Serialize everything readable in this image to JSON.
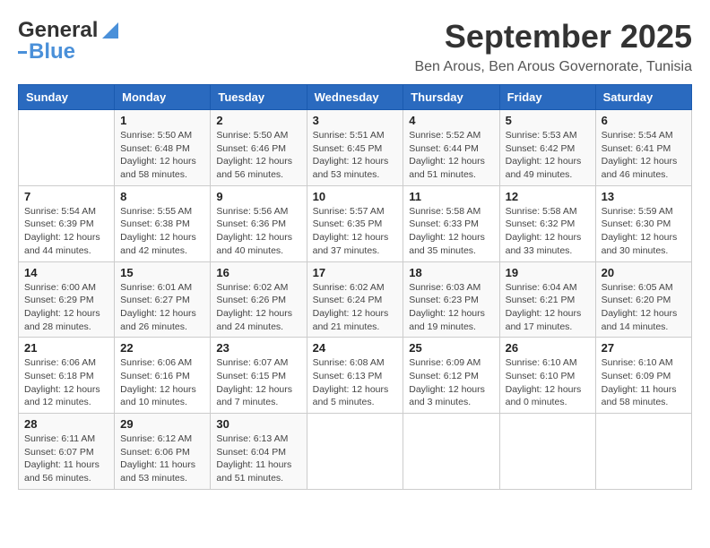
{
  "header": {
    "logo": {
      "text1": "General",
      "text2": "Blue"
    },
    "title": "September 2025",
    "location": "Ben Arous, Ben Arous Governorate, Tunisia"
  },
  "weekdays": [
    "Sunday",
    "Monday",
    "Tuesday",
    "Wednesday",
    "Thursday",
    "Friday",
    "Saturday"
  ],
  "weeks": [
    [
      {
        "day": "",
        "info": ""
      },
      {
        "day": "1",
        "info": "Sunrise: 5:50 AM\nSunset: 6:48 PM\nDaylight: 12 hours\nand 58 minutes."
      },
      {
        "day": "2",
        "info": "Sunrise: 5:50 AM\nSunset: 6:46 PM\nDaylight: 12 hours\nand 56 minutes."
      },
      {
        "day": "3",
        "info": "Sunrise: 5:51 AM\nSunset: 6:45 PM\nDaylight: 12 hours\nand 53 minutes."
      },
      {
        "day": "4",
        "info": "Sunrise: 5:52 AM\nSunset: 6:44 PM\nDaylight: 12 hours\nand 51 minutes."
      },
      {
        "day": "5",
        "info": "Sunrise: 5:53 AM\nSunset: 6:42 PM\nDaylight: 12 hours\nand 49 minutes."
      },
      {
        "day": "6",
        "info": "Sunrise: 5:54 AM\nSunset: 6:41 PM\nDaylight: 12 hours\nand 46 minutes."
      }
    ],
    [
      {
        "day": "7",
        "info": "Sunrise: 5:54 AM\nSunset: 6:39 PM\nDaylight: 12 hours\nand 44 minutes."
      },
      {
        "day": "8",
        "info": "Sunrise: 5:55 AM\nSunset: 6:38 PM\nDaylight: 12 hours\nand 42 minutes."
      },
      {
        "day": "9",
        "info": "Sunrise: 5:56 AM\nSunset: 6:36 PM\nDaylight: 12 hours\nand 40 minutes."
      },
      {
        "day": "10",
        "info": "Sunrise: 5:57 AM\nSunset: 6:35 PM\nDaylight: 12 hours\nand 37 minutes."
      },
      {
        "day": "11",
        "info": "Sunrise: 5:58 AM\nSunset: 6:33 PM\nDaylight: 12 hours\nand 35 minutes."
      },
      {
        "day": "12",
        "info": "Sunrise: 5:58 AM\nSunset: 6:32 PM\nDaylight: 12 hours\nand 33 minutes."
      },
      {
        "day": "13",
        "info": "Sunrise: 5:59 AM\nSunset: 6:30 PM\nDaylight: 12 hours\nand 30 minutes."
      }
    ],
    [
      {
        "day": "14",
        "info": "Sunrise: 6:00 AM\nSunset: 6:29 PM\nDaylight: 12 hours\nand 28 minutes."
      },
      {
        "day": "15",
        "info": "Sunrise: 6:01 AM\nSunset: 6:27 PM\nDaylight: 12 hours\nand 26 minutes."
      },
      {
        "day": "16",
        "info": "Sunrise: 6:02 AM\nSunset: 6:26 PM\nDaylight: 12 hours\nand 24 minutes."
      },
      {
        "day": "17",
        "info": "Sunrise: 6:02 AM\nSunset: 6:24 PM\nDaylight: 12 hours\nand 21 minutes."
      },
      {
        "day": "18",
        "info": "Sunrise: 6:03 AM\nSunset: 6:23 PM\nDaylight: 12 hours\nand 19 minutes."
      },
      {
        "day": "19",
        "info": "Sunrise: 6:04 AM\nSunset: 6:21 PM\nDaylight: 12 hours\nand 17 minutes."
      },
      {
        "day": "20",
        "info": "Sunrise: 6:05 AM\nSunset: 6:20 PM\nDaylight: 12 hours\nand 14 minutes."
      }
    ],
    [
      {
        "day": "21",
        "info": "Sunrise: 6:06 AM\nSunset: 6:18 PM\nDaylight: 12 hours\nand 12 minutes."
      },
      {
        "day": "22",
        "info": "Sunrise: 6:06 AM\nSunset: 6:16 PM\nDaylight: 12 hours\nand 10 minutes."
      },
      {
        "day": "23",
        "info": "Sunrise: 6:07 AM\nSunset: 6:15 PM\nDaylight: 12 hours\nand 7 minutes."
      },
      {
        "day": "24",
        "info": "Sunrise: 6:08 AM\nSunset: 6:13 PM\nDaylight: 12 hours\nand 5 minutes."
      },
      {
        "day": "25",
        "info": "Sunrise: 6:09 AM\nSunset: 6:12 PM\nDaylight: 12 hours\nand 3 minutes."
      },
      {
        "day": "26",
        "info": "Sunrise: 6:10 AM\nSunset: 6:10 PM\nDaylight: 12 hours\nand 0 minutes."
      },
      {
        "day": "27",
        "info": "Sunrise: 6:10 AM\nSunset: 6:09 PM\nDaylight: 11 hours\nand 58 minutes."
      }
    ],
    [
      {
        "day": "28",
        "info": "Sunrise: 6:11 AM\nSunset: 6:07 PM\nDaylight: 11 hours\nand 56 minutes."
      },
      {
        "day": "29",
        "info": "Sunrise: 6:12 AM\nSunset: 6:06 PM\nDaylight: 11 hours\nand 53 minutes."
      },
      {
        "day": "30",
        "info": "Sunrise: 6:13 AM\nSunset: 6:04 PM\nDaylight: 11 hours\nand 51 minutes."
      },
      {
        "day": "",
        "info": ""
      },
      {
        "day": "",
        "info": ""
      },
      {
        "day": "",
        "info": ""
      },
      {
        "day": "",
        "info": ""
      }
    ]
  ]
}
